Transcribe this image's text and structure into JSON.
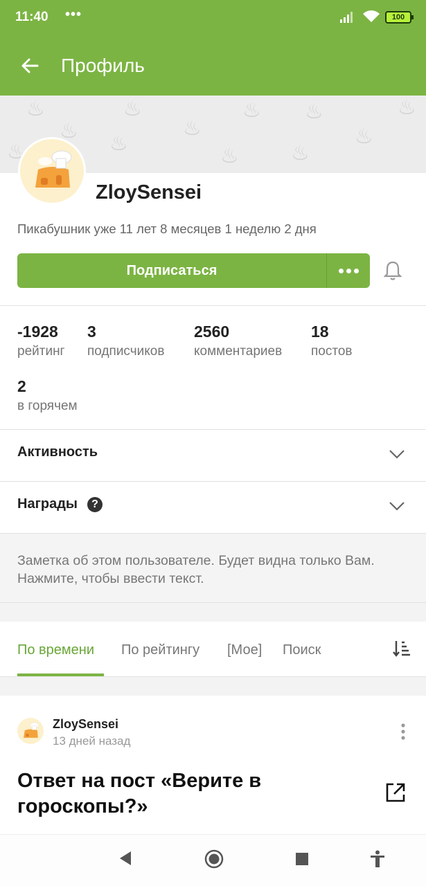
{
  "status_bar": {
    "time": "11:40",
    "dots": "•••",
    "battery": "100"
  },
  "app_bar": {
    "title": "Профиль"
  },
  "profile": {
    "username": "ZloySensei",
    "member_since": "Пикабушник уже 11 лет 8 месяцев 1 неделю 2 дня",
    "subscribe_label": "Подписаться"
  },
  "stats": [
    {
      "value": "-1928",
      "label": "рейтинг"
    },
    {
      "value": "3",
      "label": "подписчиков"
    },
    {
      "value": "2560",
      "label": "комментариев"
    },
    {
      "value": "18",
      "label": "постов"
    },
    {
      "value": "2",
      "label": "в горячем"
    }
  ],
  "sections": {
    "activity": "Активность",
    "awards": "Награды",
    "help_icon": "?"
  },
  "note": {
    "text": "Заметка об этом пользователе. Будет видна только Вам. Нажмите, чтобы ввести текст."
  },
  "tabs": [
    {
      "label": "По времени",
      "active": true
    },
    {
      "label": "По рейтингу",
      "active": false
    },
    {
      "label": "[Мое]",
      "active": false
    },
    {
      "label": "Поиск",
      "active": false
    }
  ],
  "post": {
    "author": "ZloySensei",
    "date": "13 дней назад",
    "title": "Ответ на пост «Верите в гороскопы?»"
  },
  "colors": {
    "brand_green": "#7cb443",
    "active_tab": "#6aa637"
  }
}
